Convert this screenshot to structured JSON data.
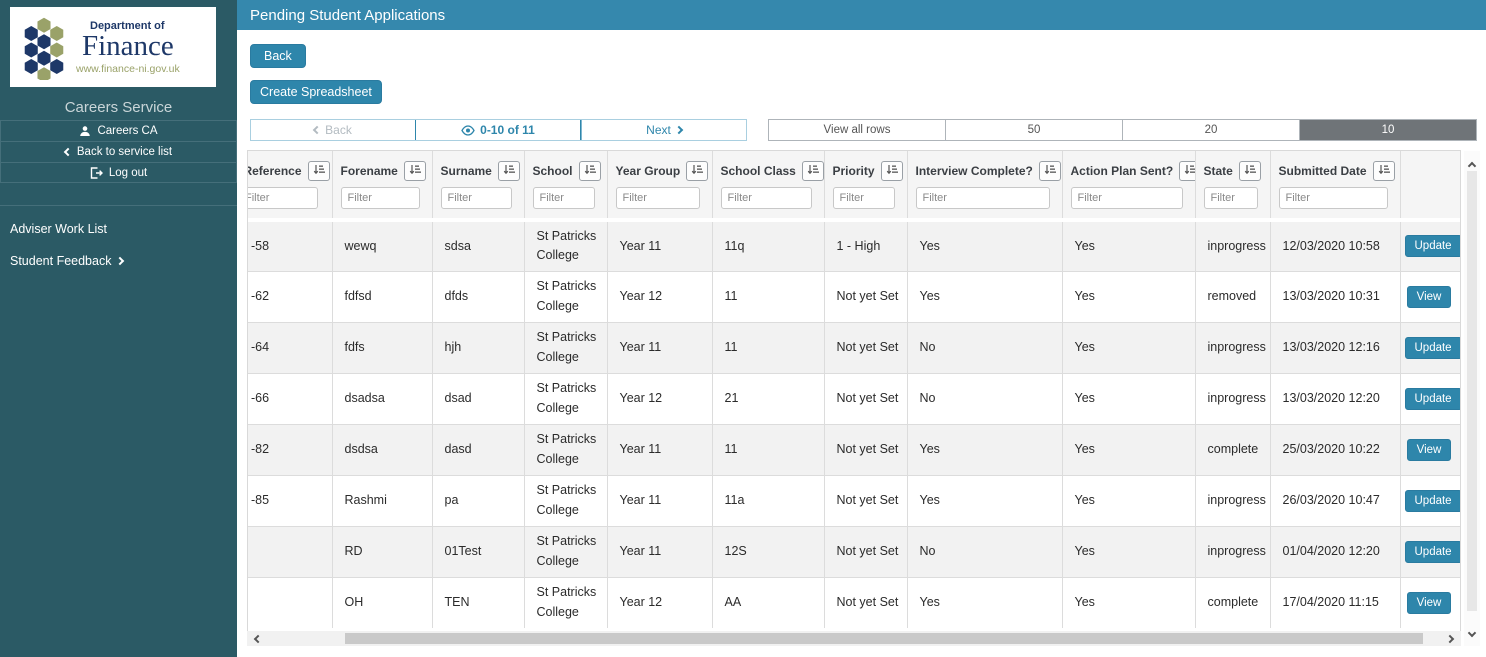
{
  "colors": {
    "accent_teal": "#2e86ab",
    "sidebar_bg": "#2b5a65",
    "titlebar_bg": "#3588ad",
    "selected_page_size_bg": "#6f7478",
    "logo_navy": "#1e3868",
    "logo_olive": "#9aa269",
    "row_alt_bg": "#f2f2f2"
  },
  "icons": {
    "hexagon-logo-icon": "honeycomb of navy and olive hexagons",
    "user-icon": "person silhouette in circle",
    "chevron-left-icon": "left angle chevron",
    "logout-icon": "door with exit arrow",
    "chevron-right-icon": "right angle chevron",
    "eye-icon": "outline eye",
    "sort-icon": "down arrow with ascending bars",
    "scroll-up-icon": "up chevron",
    "scroll-down-icon": "down chevron",
    "scroll-left-icon": "left chevron",
    "scroll-right-icon": "right chevron"
  },
  "sidebar": {
    "logo": {
      "line1": "Department of",
      "line2": "Finance",
      "line3": "www.finance-ni.gov.uk"
    },
    "service_title": "Careers Service",
    "buttons": [
      {
        "label": "Careers CA",
        "icon": "user-icon"
      },
      {
        "label": "Back to service list",
        "icon": "chevron-left-icon"
      },
      {
        "label": "Log out",
        "icon": "logout-icon"
      }
    ],
    "nav": [
      {
        "label": "Adviser Work List",
        "chevron": false
      },
      {
        "label": "Student Feedback",
        "chevron": true
      }
    ]
  },
  "header": {
    "title": "Pending Student Applications"
  },
  "toolbar": {
    "back_label": "Back",
    "create_spreadsheet_label": "Create Spreadsheet"
  },
  "pagination": {
    "back_label": "Back",
    "range_label": "0-10 of 11",
    "next_label": "Next",
    "page_sizes": [
      "View all rows",
      "50",
      "20",
      "10"
    ],
    "selected_size": "10"
  },
  "table": {
    "filter_placeholder": "Filter",
    "columns": [
      "Reference",
      "Forename",
      "Surname",
      "School",
      "Year Group",
      "School Class",
      "Priority",
      "Interview Complete?",
      "Action Plan Sent?",
      "State",
      "Submitted Date"
    ],
    "rows": [
      {
        "cells": [
          "-58",
          "wewq",
          "sdsa",
          "St Patricks College",
          "Year 11",
          "11q",
          "1 - High",
          "Yes",
          "Yes",
          "inprogress",
          "12/03/2020 10:58"
        ],
        "action": "Update"
      },
      {
        "cells": [
          "-62",
          "fdfsd",
          "dfds",
          "St Patricks College",
          "Year 12",
          "11",
          "Not yet Set",
          "Yes",
          "Yes",
          "removed",
          "13/03/2020 10:31"
        ],
        "action": "View"
      },
      {
        "cells": [
          "-64",
          "fdfs",
          "hjh",
          "St Patricks College",
          "Year 11",
          "11",
          "Not yet Set",
          "No",
          "Yes",
          "inprogress",
          "13/03/2020 12:16"
        ],
        "action": "Update"
      },
      {
        "cells": [
          "-66",
          "dsadsa",
          "dsad",
          "St Patricks College",
          "Year 12",
          "21",
          "Not yet Set",
          "No",
          "Yes",
          "inprogress",
          "13/03/2020 12:20"
        ],
        "action": "Update"
      },
      {
        "cells": [
          "-82",
          "dsdsa",
          "dasd",
          "St Patricks College",
          "Year 11",
          "11",
          "Not yet Set",
          "Yes",
          "Yes",
          "complete",
          "25/03/2020 10:22"
        ],
        "action": "View"
      },
      {
        "cells": [
          "-85",
          "Rashmi",
          "pa",
          "St Patricks College",
          "Year 11",
          "11a",
          "Not yet Set",
          "Yes",
          "Yes",
          "inprogress",
          "26/03/2020 10:47"
        ],
        "action": "Update"
      },
      {
        "cells": [
          "",
          "RD",
          "01Test",
          "St Patricks College",
          "Year 11",
          "12S",
          "Not yet Set",
          "No",
          "Yes",
          "inprogress",
          "01/04/2020 12:20"
        ],
        "action": "Update"
      },
      {
        "cells": [
          "",
          "OH",
          "TEN",
          "St Patricks College",
          "Year 12",
          "AA",
          "Not yet Set",
          "Yes",
          "Yes",
          "complete",
          "17/04/2020 11:15"
        ],
        "action": "View"
      }
    ]
  }
}
